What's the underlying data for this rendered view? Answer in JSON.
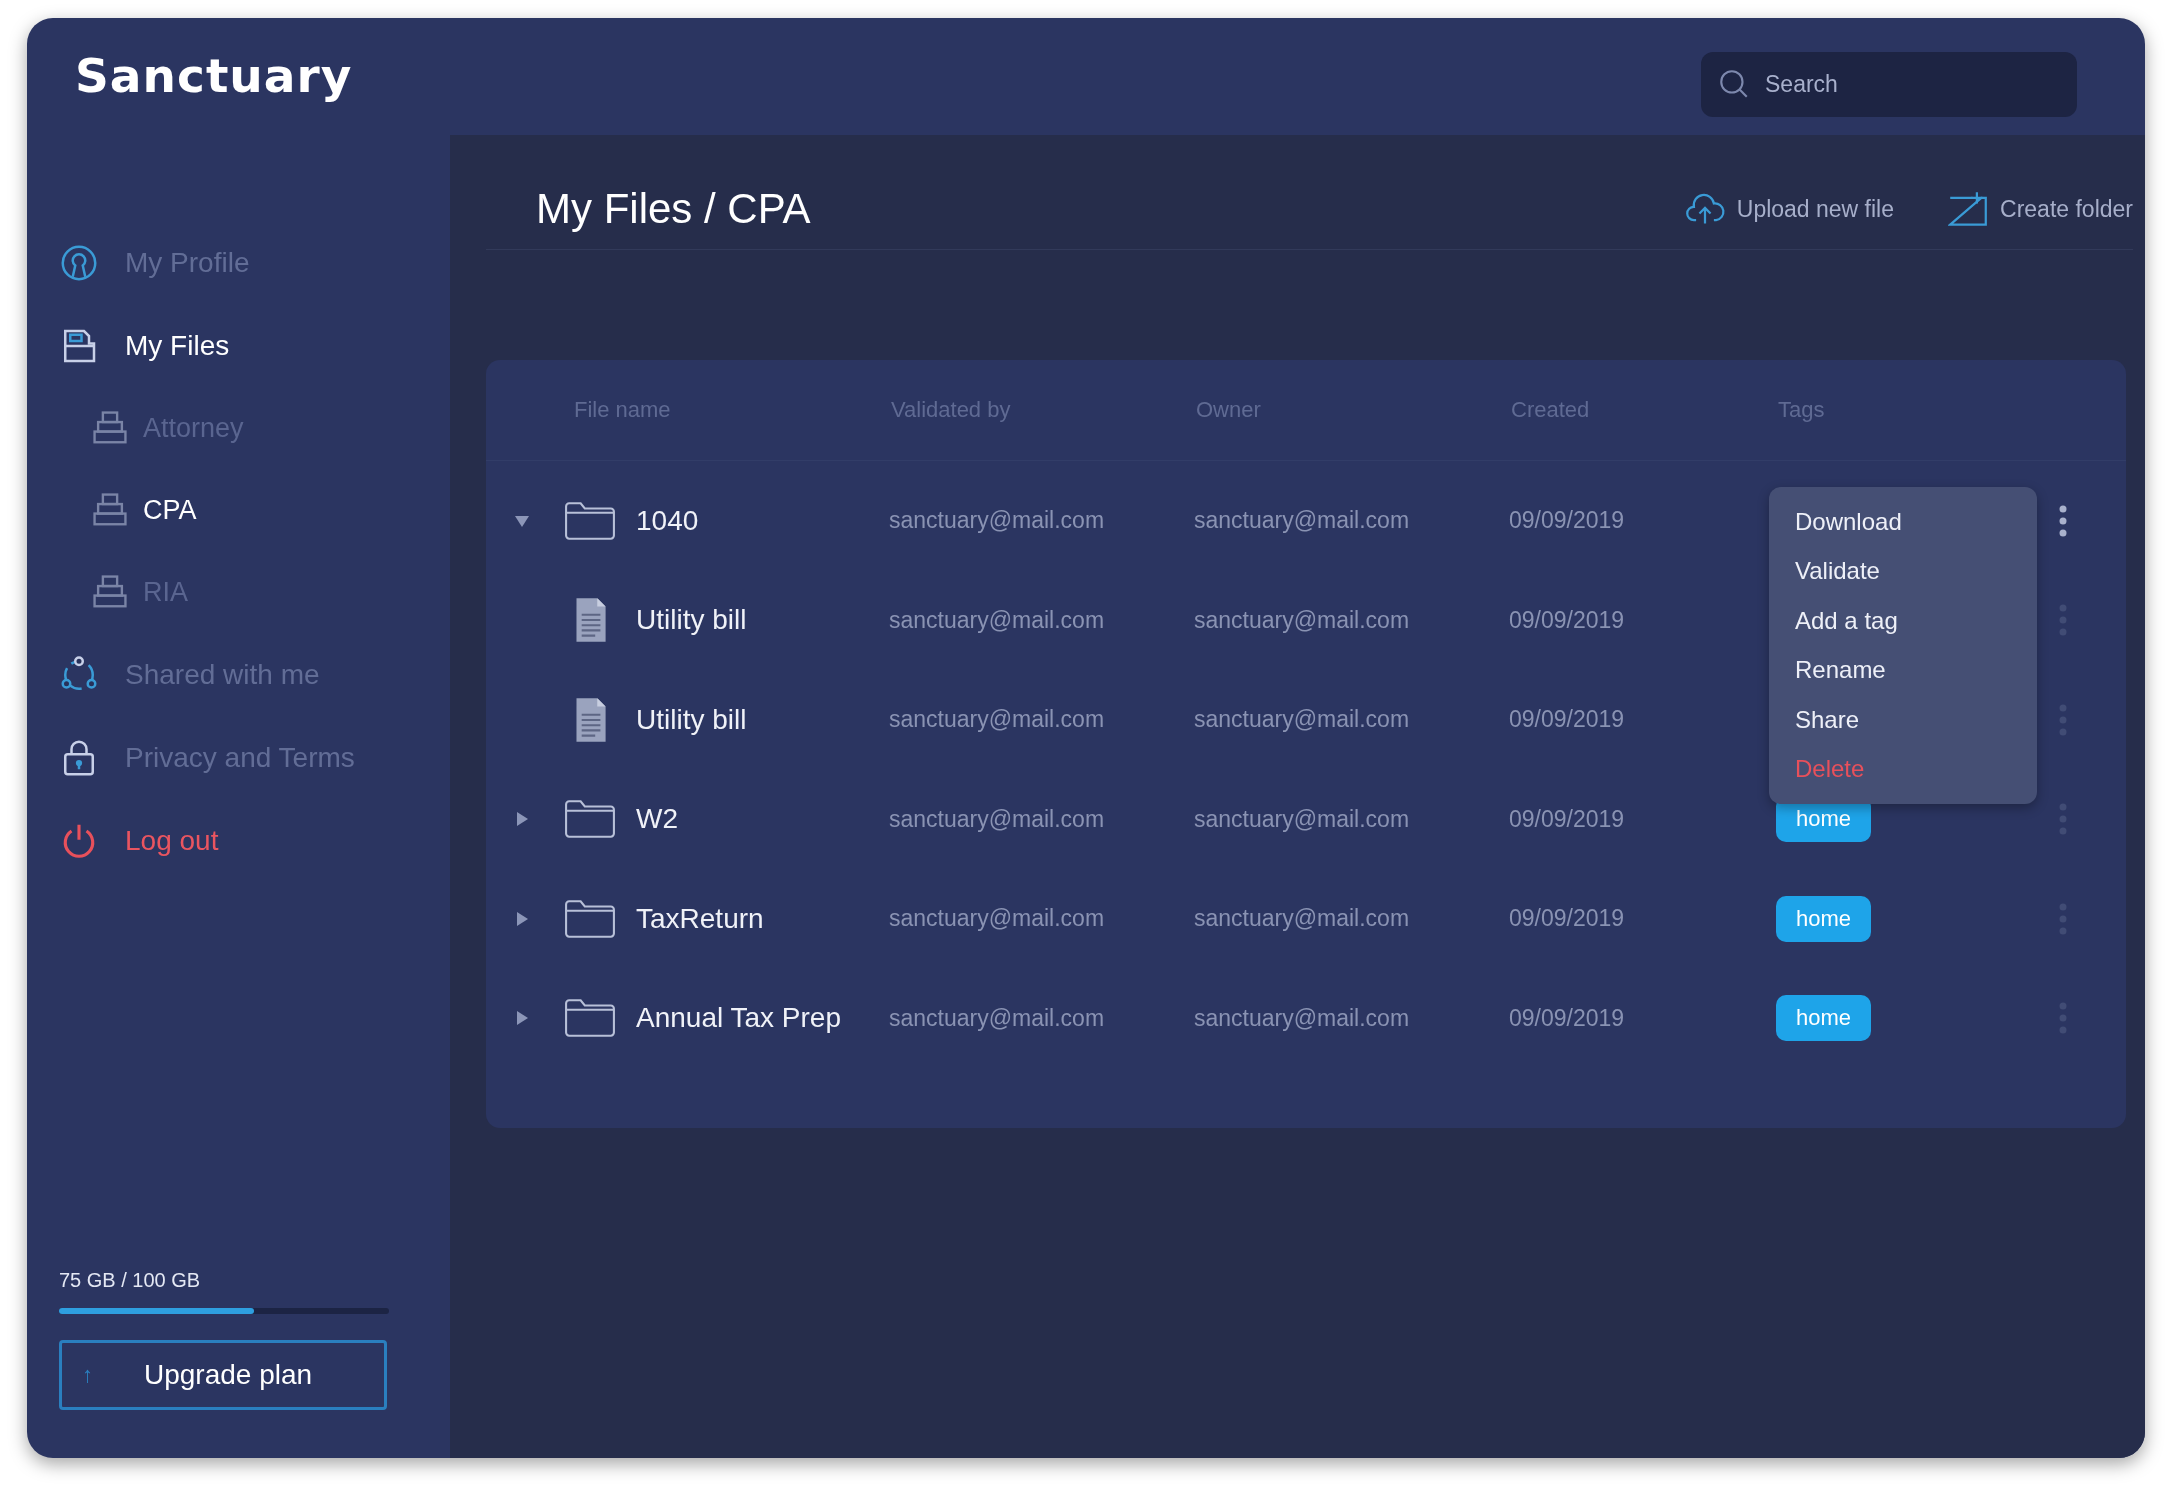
{
  "app": {
    "logo": "Sanctuary"
  },
  "search": {
    "placeholder": "Search"
  },
  "sidebar": {
    "items": [
      {
        "label": "My Profile",
        "kind": "profile",
        "selected": false
      },
      {
        "label": "My Files",
        "kind": "files",
        "selected": true,
        "children": [
          {
            "label": "Attorney",
            "selected": false
          },
          {
            "label": "CPA",
            "selected": true
          },
          {
            "label": "RIA",
            "selected": false
          }
        ]
      },
      {
        "label": "Shared with me",
        "kind": "shared",
        "selected": false
      },
      {
        "label": "Privacy and Terms",
        "kind": "privacy",
        "selected": false
      },
      {
        "label": "Log out",
        "kind": "logout",
        "selected": false
      }
    ]
  },
  "storage": {
    "label": "75 GB / 100 GB",
    "level": 0.59
  },
  "upgrade_button": {
    "icon": "↑",
    "label": "Upgrade plan"
  },
  "breadcrumb": "My Files / CPA",
  "actions": [
    {
      "kind": "upload",
      "label": "Upload new file"
    },
    {
      "kind": "folder",
      "label": "Create folder"
    }
  ],
  "table": {
    "columns": [
      "File name",
      "Validated by",
      "Owner",
      "Created",
      "Tags"
    ],
    "rows": [
      {
        "kind": "folder",
        "name": "1040",
        "validated_by": "sanctuary@mail.com",
        "owner": "sanctuary@mail.com",
        "created": "09/09/2019",
        "expanded": true,
        "menu_open": true,
        "children": [
          {
            "kind": "file",
            "name": "Utility bill",
            "validated_by": "sanctuary@mail.com",
            "owner": "sanctuary@mail.com",
            "created": "09/09/2019",
            "menu_open": false
          },
          {
            "kind": "file",
            "name": "Utility bill",
            "validated_by": "sanctuary@mail.com",
            "owner": "sanctuary@mail.com",
            "created": "09/09/2019",
            "menu_open": false
          }
        ]
      },
      {
        "kind": "folder",
        "name": "W2",
        "validated_by": "sanctuary@mail.com",
        "owner": "sanctuary@mail.com",
        "created": "09/09/2019",
        "expanded": false,
        "menu_open": false,
        "tag": "home"
      },
      {
        "kind": "folder",
        "name": "TaxReturn",
        "validated_by": "sanctuary@mail.com",
        "owner": "sanctuary@mail.com",
        "created": "09/09/2019",
        "expanded": false,
        "menu_open": false,
        "tag": "home"
      },
      {
        "kind": "folder",
        "name": "Annual Tax Prep",
        "validated_by": "sanctuary@mail.com",
        "owner": "sanctuary@mail.com",
        "created": "09/09/2019",
        "expanded": false,
        "menu_open": false,
        "tag": "home"
      }
    ]
  },
  "context_menu": {
    "items": [
      {
        "label": "Download",
        "kind": "normal"
      },
      {
        "label": "Validate",
        "kind": "normal"
      },
      {
        "label": "Add a tag",
        "kind": "normal"
      },
      {
        "label": "Rename",
        "kind": "normal"
      },
      {
        "label": "Share",
        "kind": "normal"
      },
      {
        "label": "Delete",
        "kind": "danger"
      }
    ]
  }
}
